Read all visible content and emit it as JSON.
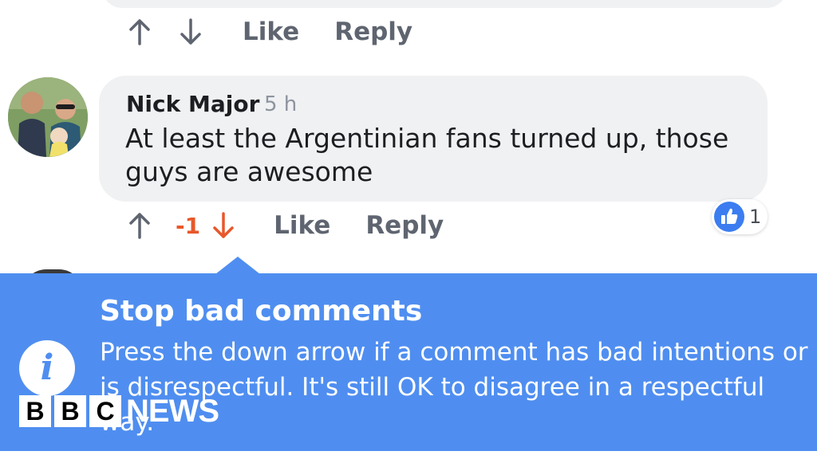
{
  "previous_comment": {
    "actions": {
      "like_label": "Like",
      "reply_label": "Reply"
    }
  },
  "comment": {
    "author": "Nick Major",
    "timestamp": "5 h",
    "text": "At least the Argentinian fans turned up, those guys are awesome",
    "score": "-1",
    "actions": {
      "like_label": "Like",
      "reply_label": "Reply"
    },
    "reaction": {
      "icon": "thumbs-up-icon",
      "count": "1",
      "color": "#3b7df0"
    }
  },
  "tooltip": {
    "title": "Stop bad comments",
    "body": "Press the down arrow if a comment has bad intentions or is disrespectful. It's still OK to disagree in a respectful way.",
    "icon": "info-icon",
    "background": "#4f8ef0"
  },
  "watermark": {
    "letters": [
      "B",
      "B",
      "C"
    ],
    "text": "NEWS"
  },
  "colors": {
    "action_gray": "#5f6570",
    "downvote_active": "#e8572a",
    "bubble_bg": "#f0f1f3"
  }
}
